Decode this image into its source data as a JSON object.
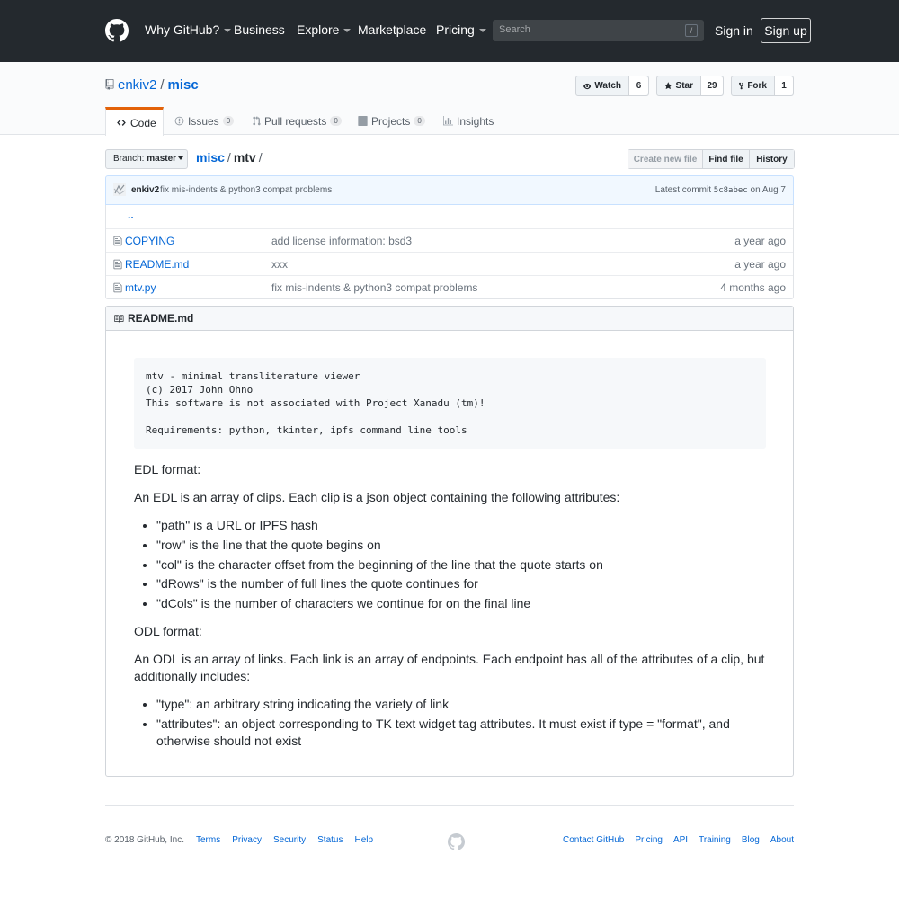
{
  "header": {
    "nav": [
      {
        "label": "Why GitHub?",
        "caret": true
      },
      {
        "label": "Business",
        "caret": false
      },
      {
        "label": "Explore",
        "caret": true
      },
      {
        "label": "Marketplace",
        "caret": false
      },
      {
        "label": "Pricing",
        "caret": true
      }
    ],
    "search_placeholder": "Search",
    "search_shortcut": "/",
    "sign_in": "Sign in",
    "sign_up": "Sign up"
  },
  "repo": {
    "owner": "enkiv2",
    "separator": "/",
    "name": "misc",
    "actions": {
      "watch_label": "Watch",
      "watch_count": "6",
      "star_label": "Star",
      "star_count": "29",
      "fork_label": "Fork",
      "fork_count": "1"
    },
    "tabs": [
      {
        "label": "Code",
        "counter": ""
      },
      {
        "label": "Issues",
        "counter": "0"
      },
      {
        "label": "Pull requests",
        "counter": "0"
      },
      {
        "label": "Projects",
        "counter": "0"
      },
      {
        "label": "Insights",
        "counter": ""
      }
    ]
  },
  "file_nav": {
    "branch_prefix": "Branch:",
    "branch": "master",
    "breadcrumb_root": "misc",
    "breadcrumb_sep": "/",
    "breadcrumb_current": "mtv",
    "breadcrumb_trailing": "/",
    "create_new_file": "Create new file",
    "find_file": "Find file",
    "history": "History"
  },
  "commit": {
    "author": "enkiv2",
    "message": "fix mis-indents & python3 compat problems",
    "latest_label": "Latest commit",
    "sha": "5c8abec",
    "date": "on Aug 7"
  },
  "files": {
    "parent": "..",
    "rows": [
      {
        "name": "COPYING",
        "message": "add license information: bsd3",
        "age": "a year ago"
      },
      {
        "name": "README.md",
        "message": "xxx",
        "age": "a year ago"
      },
      {
        "name": "mtv.py",
        "message": "fix mis-indents & python3 compat problems",
        "age": "4 months ago"
      }
    ]
  },
  "readme": {
    "title": "README.md",
    "code": "mtv - minimal transliterature viewer\n(c) 2017 John Ohno\nThis software is not associated with Project Xanadu (tm)!\n\nRequirements: python, tkinter, ipfs command line tools",
    "edl_heading": "EDL format:",
    "edl_intro": "An EDL is an array of clips. Each clip is a json object containing the following attributes:",
    "edl_items": [
      "\"path\" is a URL or IPFS hash",
      "\"row\" is the line that the quote begins on",
      "\"col\" is the character offset from the beginning of the line that the quote starts on",
      "\"dRows\" is the number of full lines the quote continues for",
      "\"dCols\" is the number of characters we continue for on the final line"
    ],
    "odl_heading": "ODL format:",
    "odl_intro": "An ODL is an array of links. Each link is an array of endpoints. Each endpoint has all of the attributes of a clip, but additionally includes:",
    "odl_items": [
      "\"type\": an arbitrary string indicating the variety of link",
      "\"attributes\": an object corresponding to TK text widget tag attributes. It must exist if type = \"format\", and otherwise should not exist"
    ]
  },
  "footer": {
    "copyright": "© 2018 GitHub, Inc.",
    "left_links": [
      "Terms",
      "Privacy",
      "Security",
      "Status",
      "Help"
    ],
    "right_links": [
      "Contact GitHub",
      "Pricing",
      "API",
      "Training",
      "Blog",
      "About"
    ]
  }
}
